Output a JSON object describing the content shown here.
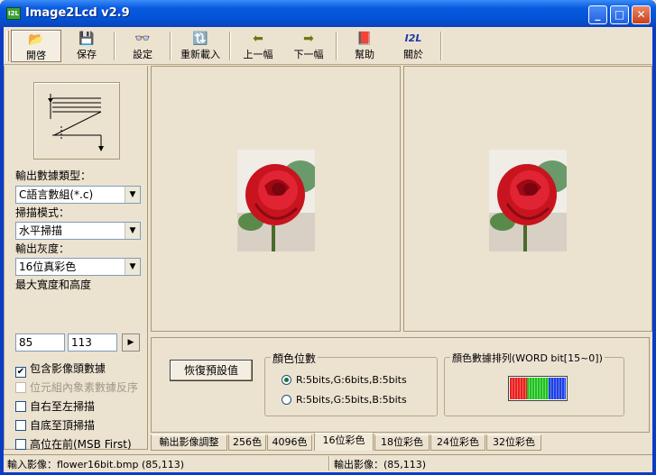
{
  "window": {
    "title": "Image2Lcd v2.9",
    "icon_text": "I2L"
  },
  "titlebar_buttons": {
    "minimize": "_",
    "maximize": "□",
    "close": "✕"
  },
  "toolbar": [
    {
      "label": "開啓",
      "icon": "folder-open-icon",
      "glyph": "📂"
    },
    {
      "label": "保存",
      "icon": "save-disk-icon",
      "glyph": "💾"
    },
    {
      "label": "設定",
      "icon": "glasses-icon",
      "glyph": "👓"
    },
    {
      "label": "重新載入",
      "icon": "reload-icon",
      "glyph": "🔃"
    },
    {
      "label": "上一幅",
      "icon": "arrow-left-icon",
      "glyph": "⬅"
    },
    {
      "label": "下一幅",
      "icon": "arrow-right-icon",
      "glyph": "➡"
    },
    {
      "label": "幫助",
      "icon": "help-book-icon",
      "glyph": "📕"
    },
    {
      "label": "關於",
      "icon": "about-logo-icon",
      "glyph": "I2L"
    }
  ],
  "left": {
    "output_type_label": "輸出數據類型：",
    "output_type_value": "C語言數組(*.c)",
    "scan_mode_label": "掃描模式：",
    "scan_mode_value": "水平掃描",
    "gray_label": "輸出灰度：",
    "gray_value": "16位真彩色",
    "size_label": "最大寬度和高度",
    "max_width": "85",
    "max_height": "113",
    "checkboxes": [
      {
        "label": "包含影像頭數據",
        "checked": true,
        "disabled": false
      },
      {
        "label": "位元組內象素數據反序",
        "checked": false,
        "disabled": true
      },
      {
        "label": "自右至左掃描",
        "checked": false,
        "disabled": false
      },
      {
        "label": "自底至頂掃描",
        "checked": false,
        "disabled": false
      },
      {
        "label": "高位在前(MSB First)",
        "checked": false,
        "disabled": false
      }
    ]
  },
  "settings": {
    "reset_label": "恢復預設值",
    "color_bits_title": "顏色位數",
    "radio1": "R:5bits,G:6bits,B:5bits",
    "radio2": "R:5bits,G:5bits,B:5bits",
    "order_title": "顏色數據排列(WORD bit[15~0])",
    "bit_colors": [
      "#e82020",
      "#20c020",
      "#2040e0"
    ]
  },
  "tabs": [
    "輸出影像調整",
    "256色",
    "4096色",
    "16位彩色",
    "18位彩色",
    "24位彩色",
    "32位彩色"
  ],
  "active_tab": "16位彩色",
  "status": {
    "input": "輸入影像：flower16bit.bmp (85,113)",
    "output": "輸出影像：(85,113)"
  },
  "colors": {
    "background": "#ece2d0",
    "titlebar": "#0352d6"
  }
}
